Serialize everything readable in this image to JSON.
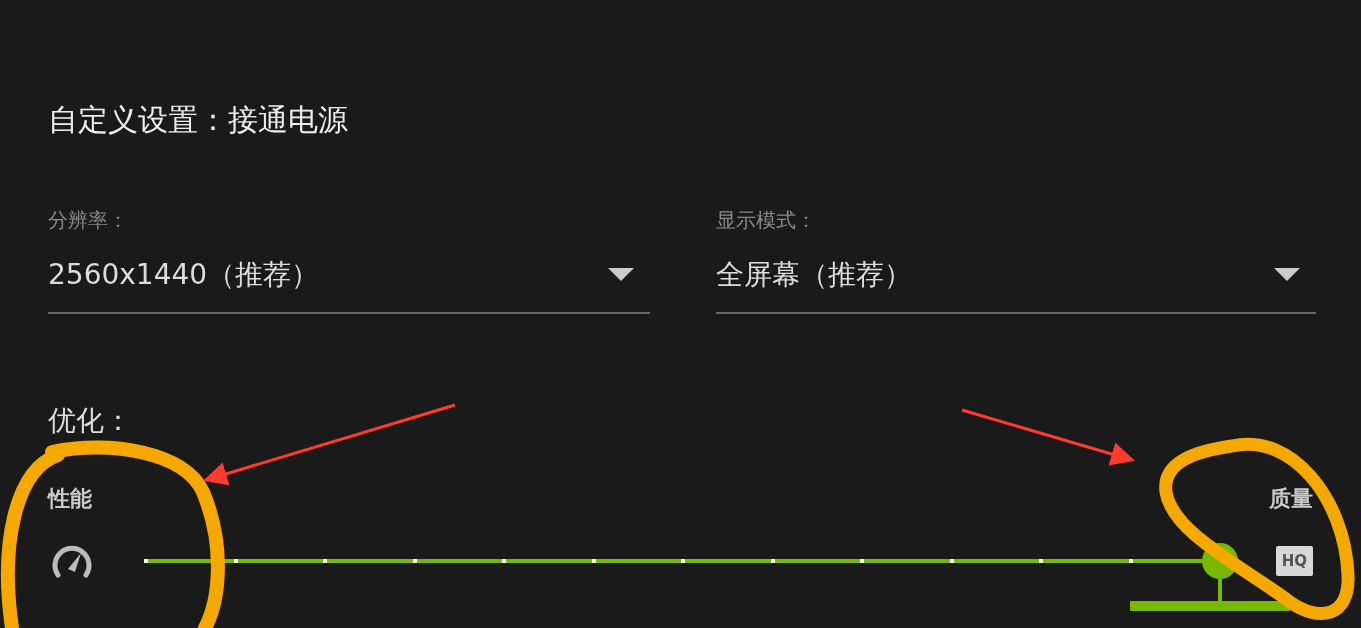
{
  "title": "自定义设置：接通电源",
  "dropdowns": [
    {
      "label": "分辨率：",
      "value": "2560x1440（推荐）"
    },
    {
      "label": "显示模式：",
      "value": "全屏幕（推荐）"
    }
  ],
  "optimization": {
    "label": "优化：",
    "left_label": "性能",
    "right_label": "质量",
    "badge": "HQ",
    "level": 1.0
  }
}
